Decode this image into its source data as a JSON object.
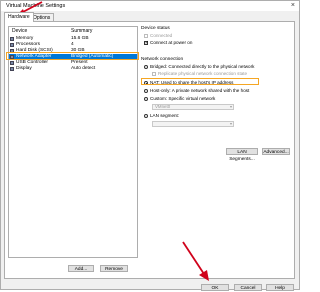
{
  "window": {
    "title": "Virtual Machine Settings",
    "close_glyph": "×"
  },
  "tabs": [
    {
      "label": "Hardware"
    },
    {
      "label": "Options"
    }
  ],
  "device_list": {
    "headers": {
      "device": "Device",
      "summary": "Summary"
    },
    "rows": [
      {
        "device": "Memory",
        "summary": "15.6 GB",
        "icon": "memory-icon"
      },
      {
        "device": "Processors",
        "summary": "4",
        "icon": "processor-icon"
      },
      {
        "device": "Hard Disk (SCSI)",
        "summary": "30 GB",
        "icon": "hard-disk-icon"
      },
      {
        "device": "Network Adapter",
        "summary": "Bridged (Automatic)",
        "icon": "network-adapter-icon",
        "selected": true
      },
      {
        "device": "USB Controller",
        "summary": "Present",
        "icon": "usb-icon"
      },
      {
        "device": "Display",
        "summary": "Auto detect",
        "icon": "display-icon"
      }
    ],
    "add_label": "Add...",
    "remove_label": "Remove"
  },
  "device_status": {
    "title": "Device status",
    "connected_label": "Connected",
    "connect_at_power_on_label": "Connect at power on"
  },
  "network_connection": {
    "title": "Network connection",
    "options": [
      {
        "label": "Bridged: Connected directly to the physical network",
        "selected": false
      },
      {
        "label": "NAT: Used to share the host's IP address",
        "selected": true
      },
      {
        "label": "Host-only: A private network shared with the host",
        "selected": false
      },
      {
        "label": "Custom: Specific virtual network",
        "selected": false
      },
      {
        "label": "LAN segment:",
        "selected": false
      }
    ],
    "replicate_label": "Replicate physical network connection state",
    "custom_select_value": "VMnet0",
    "lan_segment_value": ""
  },
  "panel_buttons": {
    "lan_segments": "LAN Segments...",
    "advanced": "Advanced..."
  },
  "dialog_buttons": {
    "ok": "OK",
    "cancel": "Cancel",
    "help": "Help"
  },
  "colors": {
    "selection": "#0078d7",
    "highlight": "#f5a623",
    "arrow": "#d0021b"
  }
}
